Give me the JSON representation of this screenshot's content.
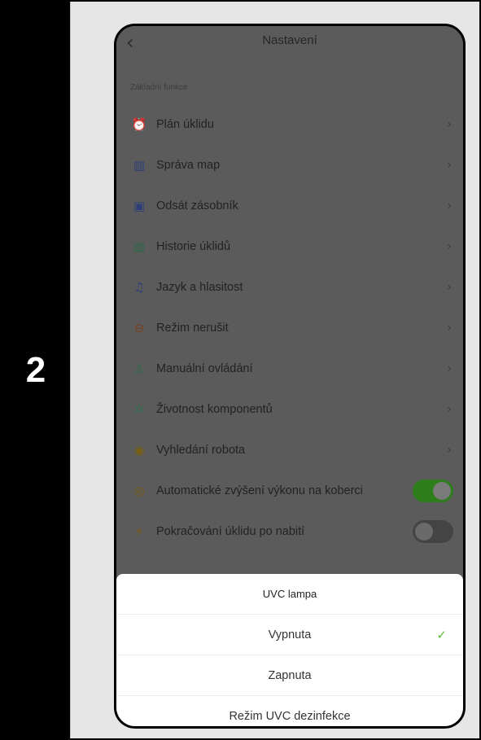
{
  "step_number": "2",
  "header": {
    "title": "Nastavení",
    "back_icon": "chevron-left-icon"
  },
  "section_label": "Základní funkce",
  "settings": [
    {
      "label": "Plán úklidu",
      "icon": "alarm-clock-icon",
      "color": "#2f6a73",
      "control": "chevron"
    },
    {
      "label": "Správa map",
      "icon": "map-icon",
      "color": "#2c3f7a",
      "control": "chevron"
    },
    {
      "label": "Odsát zásobník",
      "icon": "bin-icon",
      "color": "#2c3f7a",
      "control": "chevron"
    },
    {
      "label": "Historie úklidů",
      "icon": "history-icon",
      "color": "#2b6a48",
      "control": "chevron"
    },
    {
      "label": "Jazyk a hlasitost",
      "icon": "bell-icon",
      "color": "#2c3f7a",
      "control": "chevron"
    },
    {
      "label": "Režim nerušit",
      "icon": "do-not-disturb-icon",
      "color": "#7a3f1e",
      "control": "chevron"
    },
    {
      "label": "Manuální ovládání",
      "icon": "robot-icon",
      "color": "#2b6a48",
      "control": "chevron"
    },
    {
      "label": "Životnost komponentů",
      "icon": "components-icon",
      "color": "#3b6a55",
      "control": "chevron"
    },
    {
      "label": "Vyhledání robota",
      "icon": "location-pin-icon",
      "color": "#7a5f12",
      "control": "chevron"
    },
    {
      "label": "Automatické zvýšení výkonu na koberci",
      "icon": "boost-icon",
      "color": "#7a5f12",
      "control": "toggle",
      "state": "on"
    },
    {
      "label": "Pokračování úklidu po nabití",
      "icon": "charging-icon",
      "color": "#7a5f12",
      "control": "toggle",
      "state": "off"
    }
  ],
  "sheet": {
    "title": "UVC lampa",
    "options": [
      {
        "label": "Vypnuta",
        "selected": true
      },
      {
        "label": "Zapnuta",
        "selected": false
      },
      {
        "label": "Režim UVC dezinfekce",
        "selected": false
      }
    ],
    "check_glyph": "✓"
  },
  "colors": {
    "accent_green": "#5dbb3c",
    "toggle_on": "#2e7d1b"
  }
}
